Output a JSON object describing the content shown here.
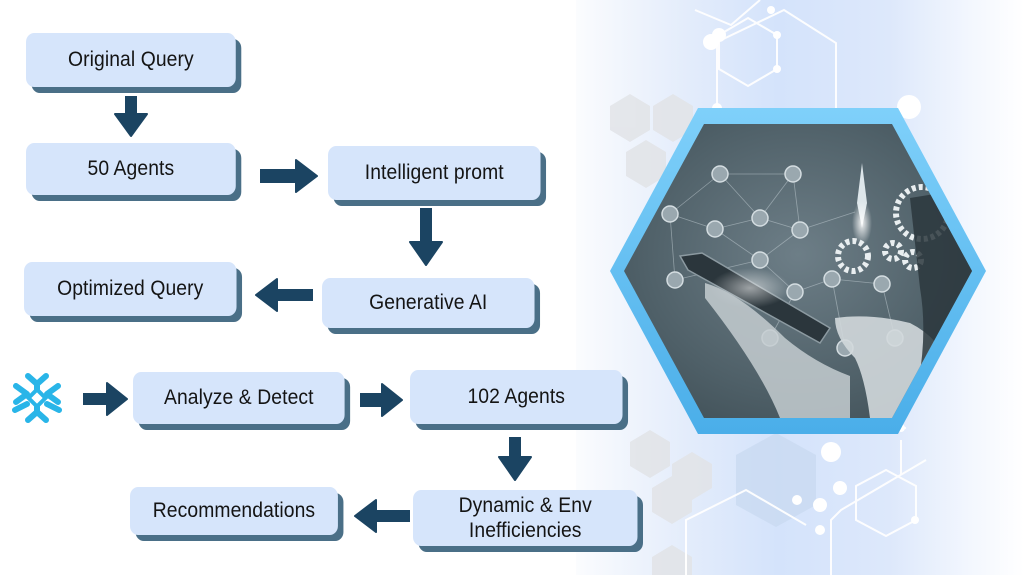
{
  "diagram": {
    "nodes": [
      {
        "id": "original-query",
        "label": "Original Query"
      },
      {
        "id": "50-agents",
        "label": "50 Agents"
      },
      {
        "id": "intelligent-prompt",
        "label": "Intelligent promt"
      },
      {
        "id": "generative-ai",
        "label": "Generative AI"
      },
      {
        "id": "optimized-query",
        "label": "Optimized Query"
      },
      {
        "id": "analyze-detect",
        "label": "Analyze & Detect"
      },
      {
        "id": "102-agents",
        "label": "102 Agents"
      },
      {
        "id": "dynamic-env",
        "label_line1": "Dynamic & Env",
        "label_line2": "Inefficiencies"
      },
      {
        "id": "recommendations",
        "label": "Recommendations"
      }
    ],
    "edges": [
      {
        "from": "original-query",
        "to": "50-agents",
        "direction": "down"
      },
      {
        "from": "50-agents",
        "to": "intelligent-prompt",
        "direction": "right"
      },
      {
        "from": "intelligent-prompt",
        "to": "generative-ai",
        "direction": "down"
      },
      {
        "from": "generative-ai",
        "to": "optimized-query",
        "direction": "left"
      },
      {
        "from": "snowflake-logo",
        "to": "analyze-detect",
        "direction": "right"
      },
      {
        "from": "analyze-detect",
        "to": "102-agents",
        "direction": "right"
      },
      {
        "from": "102-agents",
        "to": "dynamic-env",
        "direction": "down"
      },
      {
        "from": "dynamic-env",
        "to": "recommendations",
        "direction": "left"
      }
    ],
    "source_logo": "snowflake-icon",
    "illustration": "hand-holding-tablet-with-agent-network"
  },
  "colors": {
    "box_fill": "#d6e5fb",
    "box_shadow": "#4a6f87",
    "arrow": "#1b4462",
    "snowflake": "#29b5e8",
    "hex_border": "#5ab8f0",
    "hex_photo": "#4e5f68"
  }
}
